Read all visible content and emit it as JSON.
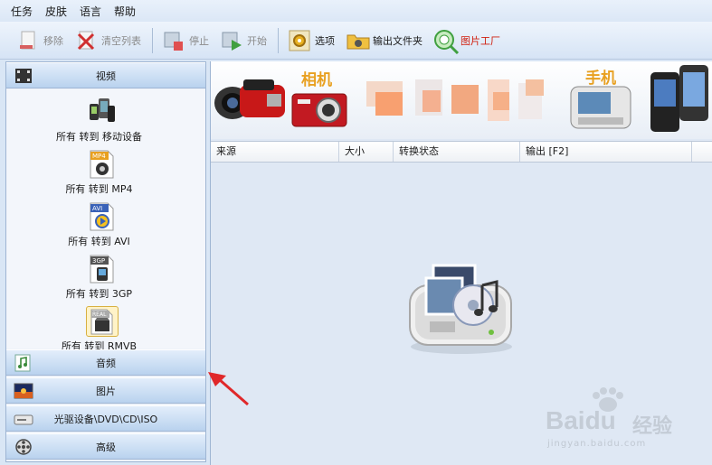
{
  "menu": [
    "任务",
    "皮肤",
    "语言",
    "帮助"
  ],
  "toolbar": {
    "remove": "移除",
    "clear_list": "清空列表",
    "stop": "停止",
    "start": "开始",
    "options": "选项",
    "output_folder": "输出文件夹",
    "picture_factory": "图片工厂"
  },
  "sidebar": {
    "video": "视频",
    "audio": "音频",
    "picture": "图片",
    "disc": "光驱设备\\DVD\\CD\\ISO",
    "advanced": "高级",
    "video_items": [
      {
        "label": "所有 转到 移动设备",
        "icon": "mobile-devices-icon"
      },
      {
        "label": "所有 转到 MP4",
        "icon": "mp4-file-icon",
        "badge": "MP4"
      },
      {
        "label": "所有 转到 AVI",
        "icon": "avi-file-icon",
        "badge": "AVI"
      },
      {
        "label": "所有 转到 3GP",
        "icon": "3gp-file-icon",
        "badge": "3GP"
      },
      {
        "label": "所有 转到 RMVB",
        "icon": "rmvb-file-icon",
        "badge": "REAL"
      }
    ]
  },
  "banner": {
    "camera_label": "相机",
    "phone_label": "手机"
  },
  "table": {
    "columns": [
      "来源",
      "大小",
      "转换状态",
      "输出 [F2]"
    ]
  },
  "watermark": {
    "brand": "Bai",
    "brand2": "du",
    "suffix": "经验",
    "url": "jingyan.baidu.com"
  },
  "colors": {
    "accent": "#4a7fc1",
    "panel": "#dfe8f4",
    "arrow": "#e0282a"
  }
}
